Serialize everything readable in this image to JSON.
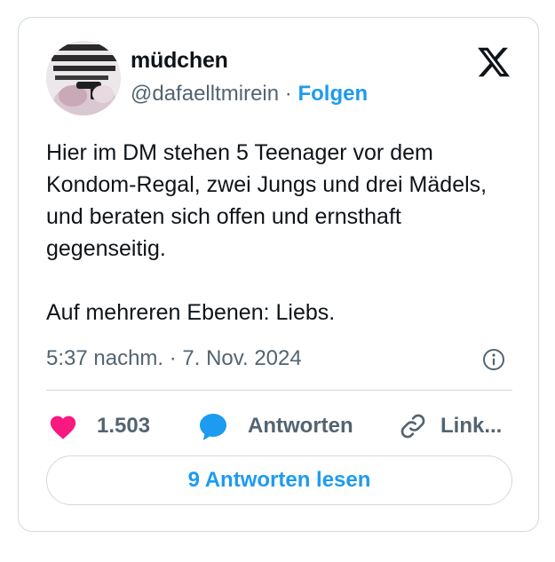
{
  "author": {
    "name": "müdchen",
    "handle": "@dafaelltmirein",
    "separator": "·",
    "follow_label": "Folgen"
  },
  "tweet": {
    "paragraphs": [
      "Hier im DM stehen 5 Teenager vor dem Kondom-Regal, zwei Jungs und drei Mädels, und beraten sich offen und ernsthaft gegenseitig.",
      "Auf mehreren Ebenen: Liebs."
    ],
    "timestamp": "5:37 nachm. · 7. Nov. 2024"
  },
  "actions": {
    "like_count": "1.503",
    "reply_label": "Antworten",
    "link_label": "Link..."
  },
  "read_replies_label": "9 Antworten lesen",
  "icons": {
    "brand": "x-logo-icon",
    "info": "info-icon",
    "like": "heart-icon",
    "reply": "speech-bubble-icon",
    "link": "link-icon"
  },
  "colors": {
    "accent": "#1d9bf0",
    "heart": "#f91880",
    "secondary_text": "#536471",
    "border": "#cfd9de"
  }
}
